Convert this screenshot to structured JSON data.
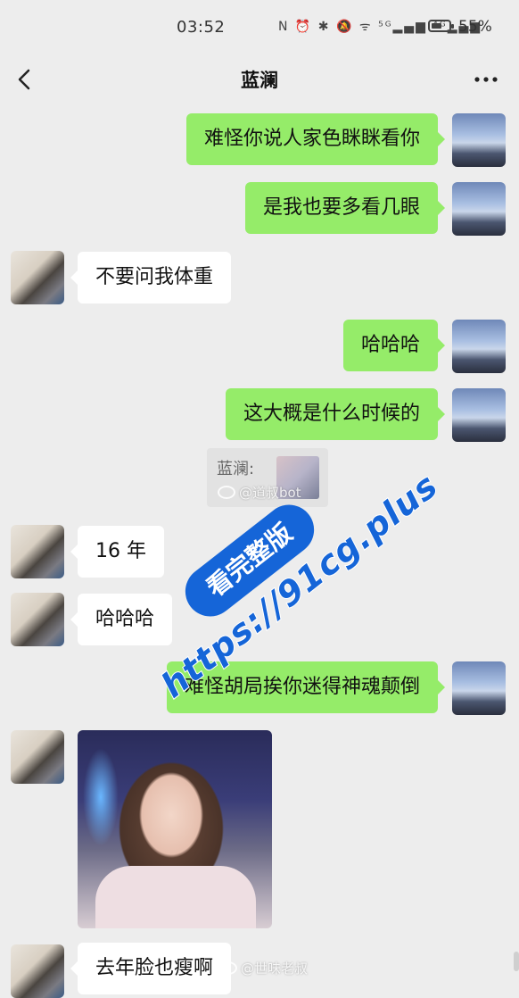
{
  "status_bar": {
    "time": "03:52",
    "battery": "55%",
    "icons": "N ⏰ ✱ 🔕 ᯤ ⁵ᴳ▂▄▆ ⁴ᴳ▂▄▆"
  },
  "header": {
    "title": "蓝澜"
  },
  "messages": [
    {
      "side": "me",
      "text": "难怪你说人家色眯眯看你"
    },
    {
      "side": "me",
      "text": "是我也要多看几眼"
    },
    {
      "side": "her",
      "text": "不要问我体重"
    },
    {
      "side": "me",
      "text": "哈哈哈"
    },
    {
      "side": "me",
      "text": "这大概是什么时候的"
    },
    {
      "side": "me",
      "quote_label": "蓝澜:"
    },
    {
      "side": "her",
      "text": "16 年"
    },
    {
      "side": "her",
      "text": "哈哈哈"
    },
    {
      "side": "me",
      "text": "难怪胡局挨你迷得神魂颠倒"
    },
    {
      "side": "her",
      "image": "photo"
    },
    {
      "side": "her",
      "text": "去年脸也瘦啊"
    }
  ],
  "watermarks": {
    "banner": "看完整版",
    "url": "https://91cg.plus",
    "weibo_1": "@道叔bot",
    "weibo_2": "@世味老叔"
  }
}
